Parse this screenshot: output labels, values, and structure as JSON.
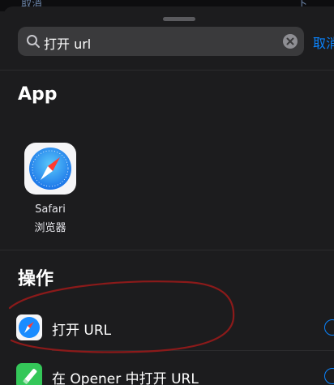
{
  "top_peek": {
    "left": "取消",
    "right": "下"
  },
  "search": {
    "query": "打开 url",
    "icon": "magnifier-icon",
    "clear_icon": "clear-x-icon"
  },
  "cancel_label": "取消",
  "sections": {
    "apps_title": "App",
    "actions_title": "操作"
  },
  "apps": [
    {
      "name": "Safari",
      "subtitle": "浏览器",
      "icon": "safari-compass-icon"
    }
  ],
  "actions": [
    {
      "label": "打开 URL",
      "icon": "safari-compass-icon"
    },
    {
      "label": "在 Opener 中打开 URL",
      "icon": "opener-icon"
    }
  ],
  "colors": {
    "background": "#1c1c1e",
    "accent": "#0a84ff",
    "search_field": "#3a3a3c",
    "annotation": "#8b1a1a",
    "opener_green": "#34c759"
  }
}
